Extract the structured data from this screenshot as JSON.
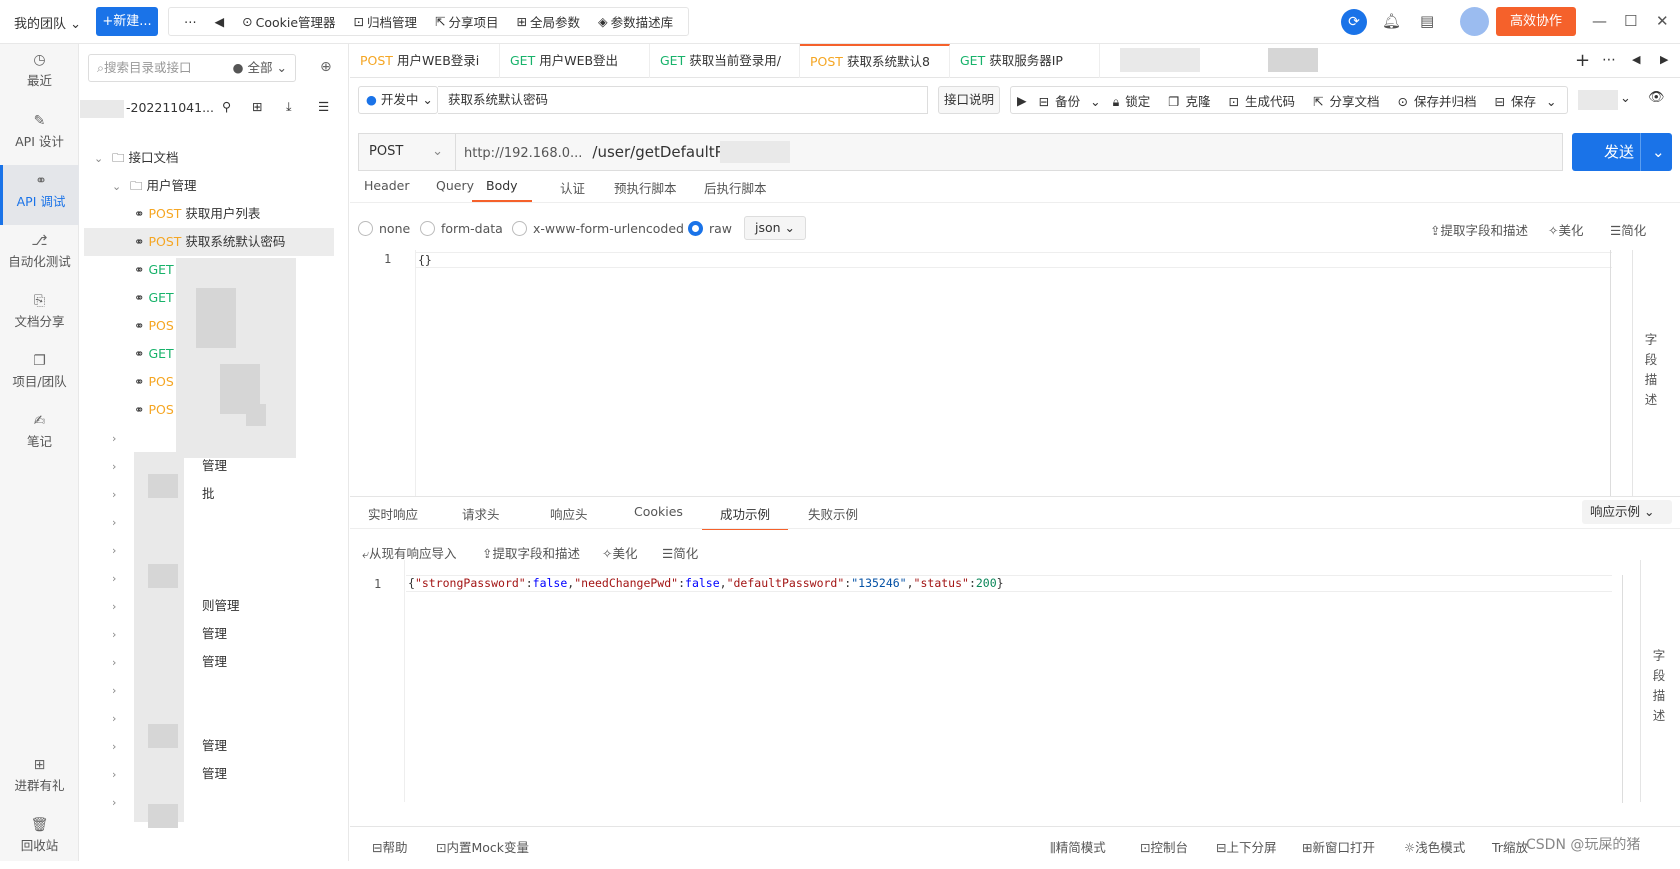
{
  "topbar": {
    "team": "我的团队",
    "new_button": "+新建...",
    "tools": [
      "Cookie管理器",
      "归档管理",
      "分享项目",
      "全局参数",
      "参数描述库"
    ],
    "collab_button": "高效协作"
  },
  "leftnav": {
    "items": [
      {
        "label": "最近",
        "icon": "clock-icon"
      },
      {
        "label": "API 设计",
        "icon": "edit-icon"
      },
      {
        "label": "API 调试",
        "icon": "link-icon"
      },
      {
        "label": "自动化测试",
        "icon": "flow-icon"
      },
      {
        "label": "文档分享",
        "icon": "doc-icon"
      },
      {
        "label": "项目/团队",
        "icon": "copy-icon"
      },
      {
        "label": "笔记",
        "icon": "note-icon"
      },
      {
        "label": "进群有礼",
        "icon": "group-icon"
      },
      {
        "label": "回收站",
        "icon": "trash-icon"
      }
    ]
  },
  "tree": {
    "search_placeholder": "搜索目录或接口",
    "filter": "全部",
    "project": "-202211041...",
    "root": "接口文档",
    "folder": "用户管理",
    "items": [
      {
        "method": "POST",
        "label": "获取用户列表"
      },
      {
        "method": "POST",
        "label": "获取系统默认密码"
      },
      {
        "method": "GET",
        "label": ""
      },
      {
        "method": "GET",
        "label": ""
      },
      {
        "method": "POS",
        "label": ""
      },
      {
        "method": "GET",
        "label": ""
      },
      {
        "method": "POS",
        "label": ""
      },
      {
        "method": "POS",
        "label": ""
      }
    ],
    "subfolders": [
      "",
      "管理",
      "批",
      "",
      "",
      "",
      "则管理",
      "管理",
      "管理",
      "",
      "",
      "管理",
      "管理",
      ""
    ]
  },
  "tabs": [
    {
      "method": "POST",
      "label": "用户WEB登录i"
    },
    {
      "method": "GET",
      "label": "用户WEB登出"
    },
    {
      "method": "GET",
      "label": "获取当前登录用/"
    },
    {
      "method": "POST",
      "label": "获取系统默认8"
    },
    {
      "method": "GET",
      "label": "获取服务器IP"
    }
  ],
  "request": {
    "status": "开发中",
    "name": "获取系统默认密码",
    "desc_button": "接口说明",
    "actions": [
      "备份",
      "锁定",
      "克隆",
      "生成代码",
      "分享文档",
      "保存并归档",
      "保存"
    ],
    "method": "POST",
    "url_host": "http://192.168.0...",
    "url_path": "/user/getDefaultPa",
    "send": "发送",
    "tabs": [
      "Header",
      "Query",
      "Body",
      "认证",
      "预执行脚本",
      "后执行脚本"
    ],
    "body_types": [
      "none",
      "form-data",
      "x-www-form-urlencoded",
      "raw"
    ],
    "body_format": "json",
    "body_tools": [
      "提取字段和描述",
      "美化",
      "简化"
    ],
    "body_line": "1",
    "body_code": "{}",
    "side_label": "字段描述"
  },
  "response": {
    "tabs": [
      "实时响应",
      "请求头",
      "响应头",
      "Cookies",
      "成功示例",
      "失败示例"
    ],
    "example_select": "响应示例",
    "tools": [
      "从现有响应导入",
      "提取字段和描述",
      "美化",
      "简化"
    ],
    "line": "1",
    "json": {
      "k1": "\"strongPassword\"",
      "v1": "false",
      "k2": "\"needChangePwd\"",
      "v2": "false",
      "k3": "\"defaultPassword\"",
      "v3": "\"135246\"",
      "k4": "\"status\"",
      "v4": "200"
    }
  },
  "footer": {
    "left": [
      "帮助",
      "内置Mock变量"
    ],
    "right": [
      "精简模式",
      "控制台",
      "上下分屏",
      "新窗口打开",
      "浅色模式",
      "缩放"
    ],
    "watermark": "CSDN @玩屎的猪"
  }
}
